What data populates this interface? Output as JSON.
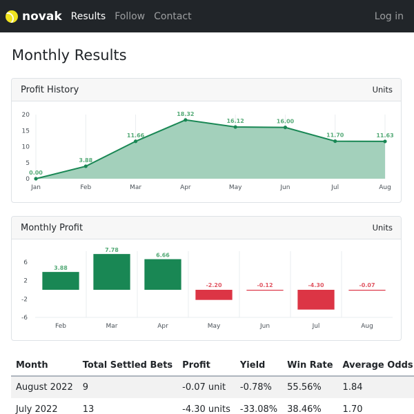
{
  "nav": {
    "brand": "novak",
    "links": [
      "Results",
      "Follow",
      "Contact"
    ],
    "login": "Log in"
  },
  "page": {
    "title": "Monthly Results"
  },
  "profit_history": {
    "title": "Profit History",
    "unit_label": "Units",
    "fill_color": "#a3d0bb",
    "line_color": "#198754"
  },
  "monthly_profit": {
    "title": "Monthly Profit",
    "unit_label": "Units",
    "positive_color": "#198754",
    "negative_color": "#dc3545"
  },
  "chart_data": [
    {
      "type": "area",
      "title": "Profit History",
      "ylabel": "Units",
      "x": [
        "Jan",
        "Feb",
        "Mar",
        "Apr",
        "May",
        "Jun",
        "Jul",
        "Aug"
      ],
      "values": [
        0.0,
        3.88,
        11.66,
        18.32,
        16.12,
        16.0,
        11.7,
        11.63
      ],
      "data_labels": [
        "0.00",
        "3.88",
        "11.66",
        "18.32",
        "16.12",
        "16.00",
        "11.70",
        "11.63"
      ],
      "yticks": [
        0,
        5,
        10,
        15,
        20
      ],
      "ytick_labels": [
        "0",
        "5",
        "10",
        "15",
        "20"
      ],
      "ylim": [
        0,
        20
      ],
      "grid": "vertical"
    },
    {
      "type": "bar",
      "title": "Monthly Profit",
      "ylabel": "Units",
      "categories": [
        "Feb",
        "Mar",
        "Apr",
        "May",
        "Jun",
        "Jul",
        "Aug"
      ],
      "values": [
        3.88,
        7.78,
        6.66,
        -2.2,
        -0.12,
        -4.3,
        -0.07
      ],
      "data_labels": [
        "3.88",
        "7.78",
        "6.66",
        "-2.20",
        "-0.12",
        "-4.30",
        "-0.07"
      ],
      "yticks": [
        6,
        2,
        -2,
        -6
      ],
      "ytick_labels": [
        "6",
        "2",
        "-2",
        "-6"
      ],
      "ylim": [
        -6,
        8
      ],
      "grid": "vertical"
    }
  ],
  "table": {
    "headers": [
      "Month",
      "Total Settled Bets",
      "Profit",
      "Yield",
      "Win Rate",
      "Average Odds"
    ],
    "rows": [
      [
        "August 2022",
        "9",
        "-0.07 unit",
        "-0.78%",
        "55.56%",
        "1.84"
      ],
      [
        "July 2022",
        "13",
        "-4.30 units",
        "-33.08%",
        "38.46%",
        "1.70"
      ]
    ]
  }
}
